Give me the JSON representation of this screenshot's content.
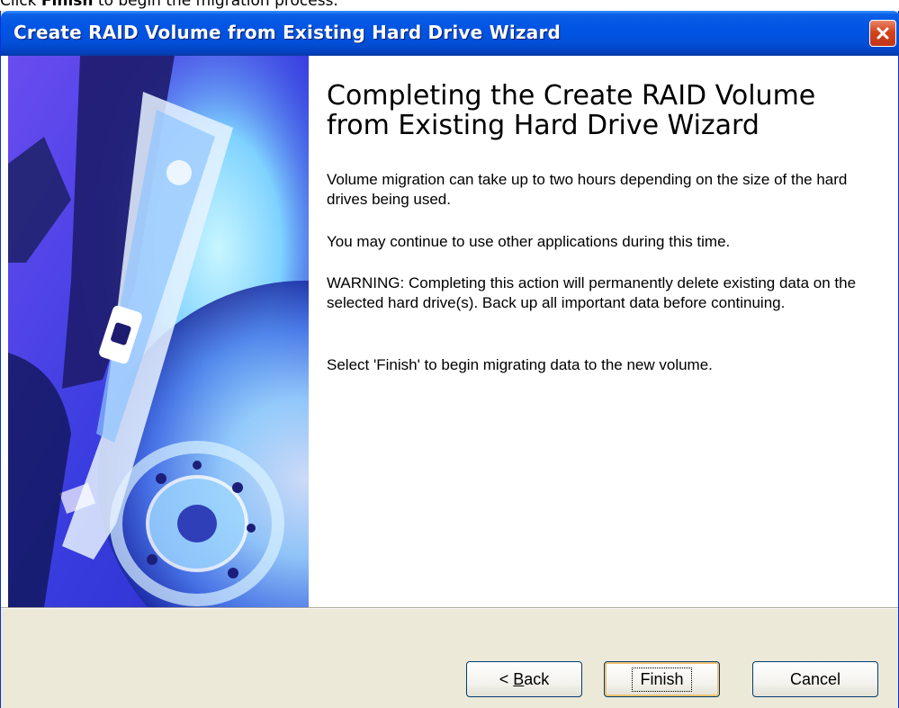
{
  "instruction": {
    "prefix": "Click ",
    "bold": "Finish",
    "suffix": " to begin the migration process."
  },
  "window": {
    "title": "Create RAID Volume from Existing Hard Drive Wizard"
  },
  "content": {
    "heading": "Completing the Create RAID Volume from Existing Hard Drive Wizard",
    "paragraphs": [
      "Volume migration can take up to two hours depending on the size of the hard drives being used.",
      "You may continue to use other applications during this time.",
      "WARNING: Completing this action will permanently delete existing data on the selected hard drive(s). Back up all important data before continuing.",
      "Select 'Finish' to begin migrating data to the new volume."
    ]
  },
  "buttons": {
    "back_prefix": "< ",
    "back_hotkey": "B",
    "back_rest": "ack",
    "finish": "Finish",
    "cancel": "Cancel"
  },
  "icons": {
    "close": "close-icon",
    "side_image": "hard-drive-platter-image"
  },
  "colors": {
    "titlebar": "#0054e3",
    "dialog_bg": "#ece9d8",
    "close_button": "#d2441b",
    "image_accent": "#2b2bd9"
  }
}
